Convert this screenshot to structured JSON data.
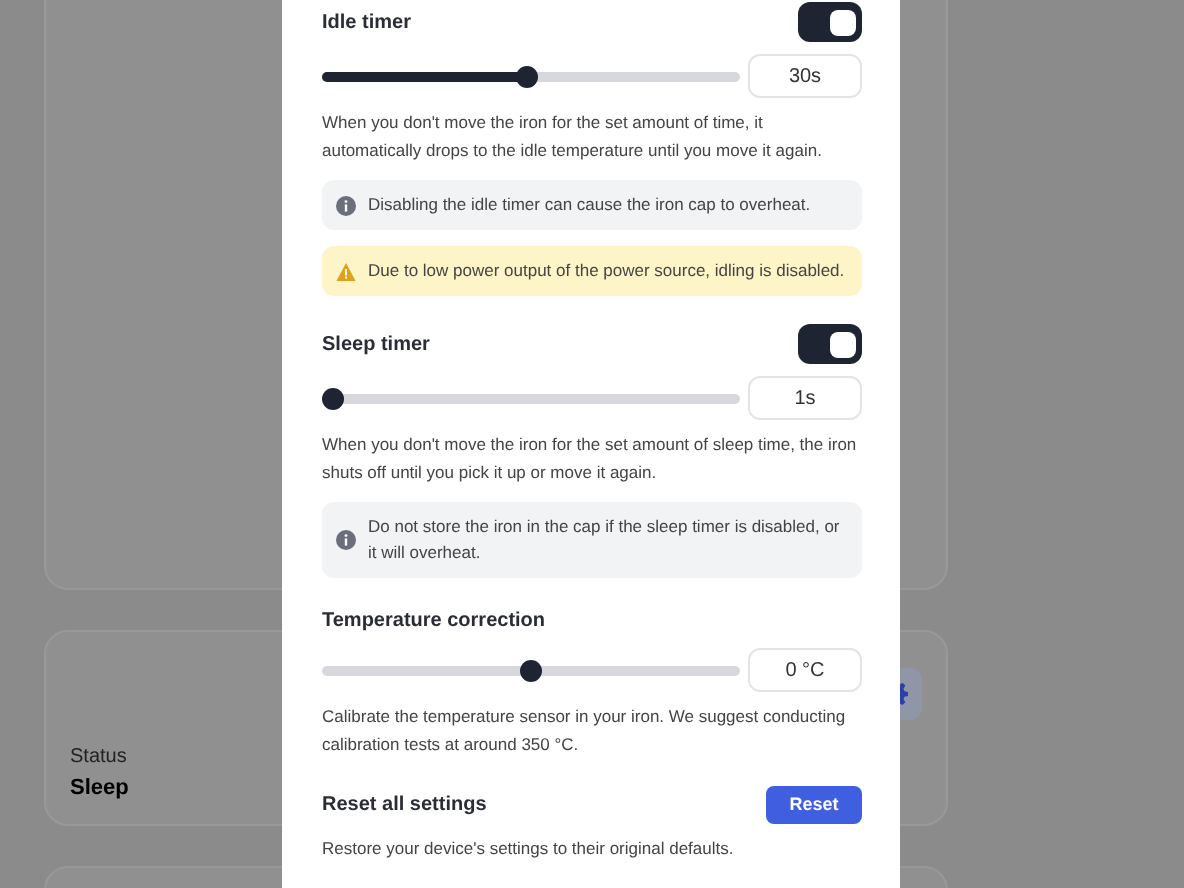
{
  "background": {
    "status_label": "Status",
    "status_value": "Sleep"
  },
  "settings": [
    {
      "kind": "timer",
      "title": "Idle timer",
      "enabled": true,
      "level": 0.49,
      "value": "30s",
      "description": "When you don't move the iron for the set amount of time, it automatically drops to the idle temperature until you move it again.",
      "notices": [
        {
          "kind": "info",
          "text": "Disabling the idle timer can cause the iron cap to overheat."
        },
        {
          "kind": "warning",
          "text": "Due to low power output of the power source, idling is disabled."
        }
      ]
    },
    {
      "kind": "timer",
      "title": "Sleep timer",
      "enabled": true,
      "level": 0,
      "value": "1s",
      "description": "When you don't move the iron for the set amount of sleep time, the iron shuts off until you pick it up or move it again.",
      "notices": [
        {
          "kind": "info",
          "text": "Do not store the iron in the cap if the sleep timer is disabled, or it will overheat."
        }
      ]
    },
    {
      "kind": "slider",
      "title": "Temperature correction",
      "level": 0.5,
      "value": "0 °C",
      "description": "Calibrate the temperature sensor in your iron. We suggest conducting calibration tests at around 350 °C."
    },
    {
      "kind": "action",
      "title": "Reset all settings",
      "button": "Reset",
      "description": "Restore your device's settings to their original defaults."
    }
  ]
}
